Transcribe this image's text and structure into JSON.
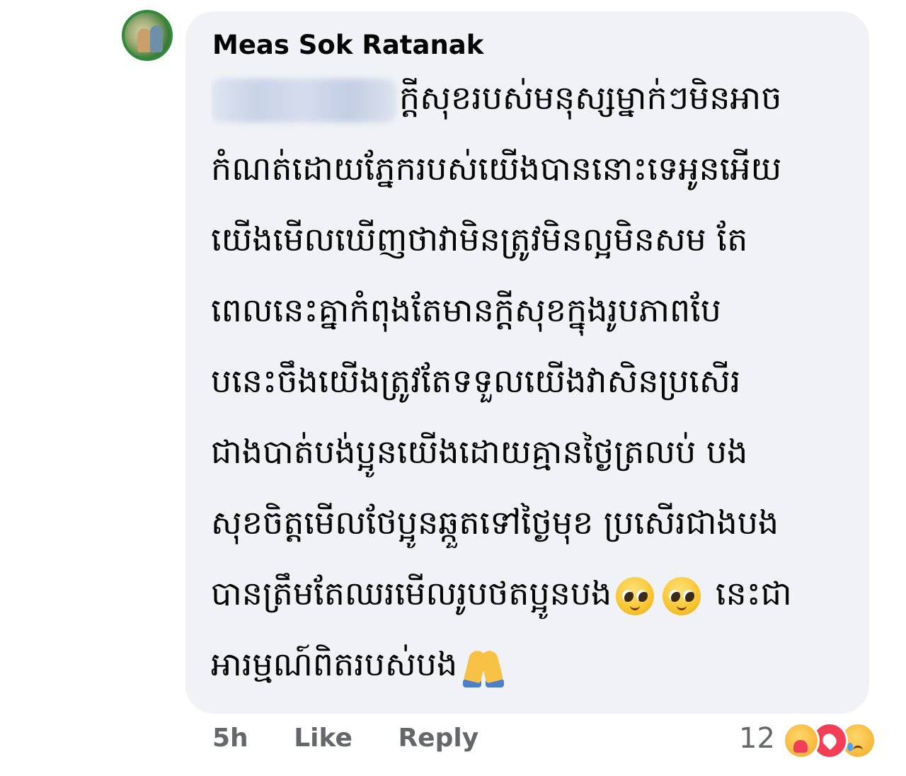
{
  "comment": {
    "author": "Meas Sok Ratanak",
    "lines": [
      "ក្តីសុខរបស់មនុស្សម្នាក់ៗមិនអាច",
      "កំណត់ដោយភ្នែករបស់យើងបាននោះទេអូនអើយ",
      "យើងមើលឃើញថាវាមិនត្រូវមិនល្អមិនសម តែ",
      "ពេលនេះគ្នាកំពុងតែមានក្ដីសុខក្នុងរូបភាពបែ",
      "បនេះចឹងយើងត្រូវតែទទួលយើងវាសិនប្រសើរ",
      "ជាងបាត់បង់ប្អូនយើងដោយគ្មានថ្ងៃត្រលប់ បង",
      "សុខចិត្តមើលថែប្អូនឆ្កួតទៅថ្ងៃមុខ ប្រសើរជាងបង",
      "បានត្រឹមតែឈរមើលរូបថតប្អូនបង",
      " នេះជា",
      "អារម្មណ៍ពិតរបស់បង"
    ],
    "emoji": {
      "line8": [
        "pleading-face-emoji",
        "pleading-face-emoji"
      ],
      "line9": [
        "folded-hands-emoji"
      ]
    }
  },
  "actions": {
    "time": "5h",
    "like": "Like",
    "reply": "Reply"
  },
  "reactions": {
    "count": "12",
    "icons": [
      "care-reaction-icon",
      "love-reaction-icon",
      "sad-reaction-icon"
    ]
  },
  "colors": {
    "bubble": "#f0f2f5",
    "meta_text": "#65676b",
    "text": "#050505",
    "love": "#f33e58"
  }
}
